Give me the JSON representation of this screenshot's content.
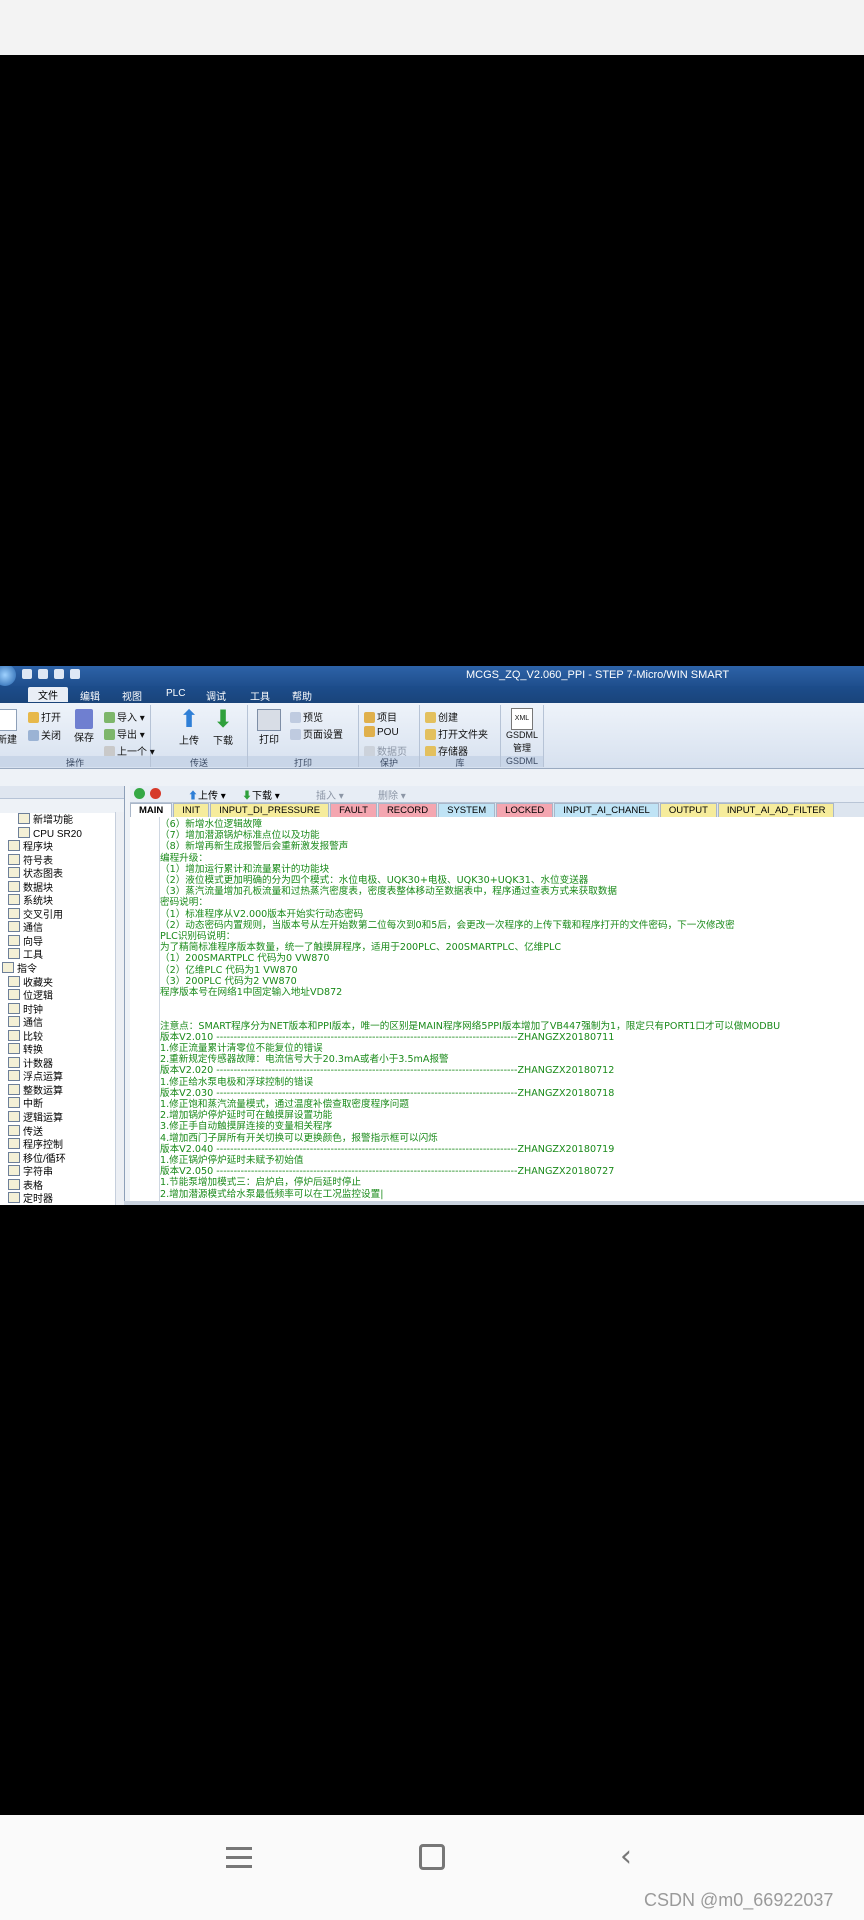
{
  "window": {
    "title": "MCGS_ZQ_V2.060_PPI - STEP 7-Micro/WIN SMART"
  },
  "menu": [
    "文件",
    "编辑",
    "视图",
    "PLC",
    "调试",
    "工具",
    "帮助"
  ],
  "ribbon": {
    "groups": [
      {
        "label": "操作",
        "items": [
          "新建",
          "打开",
          "关闭",
          "保存",
          "导入",
          "导出",
          "上一个"
        ]
      },
      {
        "label": "传送",
        "items": [
          "上传",
          "下载"
        ]
      },
      {
        "label": "打印",
        "items": [
          "打印",
          "预览",
          "页面设置"
        ]
      },
      {
        "label": "保护",
        "items": [
          "项目",
          "POU",
          "数据页"
        ]
      },
      {
        "label": "库",
        "items": [
          "创建",
          "打开文件夹",
          "存储器"
        ]
      },
      {
        "label": "GSDML",
        "items": [
          "XML",
          "GSDML 管理"
        ]
      }
    ]
  },
  "tree": {
    "items": [
      "新增功能",
      "CPU SR20",
      "程序块",
      "符号表",
      "状态图表",
      "数据块",
      "系统块",
      "交叉引用",
      "通信",
      "向导",
      "工具",
      "指令",
      "收藏夹",
      "位逻辑",
      "时钟",
      "通信",
      "比较",
      "转换",
      "计数器",
      "浮点运算",
      "整数运算",
      "中断",
      "逻辑运算",
      "传送",
      "程序控制",
      "移位/循环",
      "字符串",
      "表格",
      "定时器"
    ]
  },
  "editor_toolbar": {
    "upload": "上传",
    "download": "下载",
    "insert": "插入",
    "delete": "删除"
  },
  "tabs": [
    "MAIN",
    "INIT",
    "INPUT_DI_PRESSURE",
    "FAULT",
    "RECORD",
    "SYSTEM",
    "LOCKED",
    "INPUT_AI_CHANEL",
    "OUTPUT",
    "INPUT_AI_AD_FILTER"
  ],
  "editor_lines": [
    "（6）新增水位逻辑故障",
    "（7）增加潜源锅炉标准点位以及功能",
    "（8）新增再新生成报警后会重新激发报警声",
    "编程升级：",
    "（1）增加运行累计和流量累计的功能块",
    "（2）液位模式更加明确的分为四个模式：水位电极、UQK30+电极、UQK30+UQK31、水位变送器",
    "（3）蒸汽流量增加孔板流量和过热蒸汽密度表，密度表整体移动至数据表中，程序通过查表方式来获取数据",
    "密码说明：",
    "（1）标准程序从V2.000版本开始实行动态密码",
    "（2）动态密码内置规则，当版本号从左开始数第二位每次到0和5后，会更改一次程序的上传下载和程序打开的文件密码，下一次修改密",
    "PLC识别码说明：",
    "为了精简标准程序版本数量，统一了触摸屏程序，适用于200PLC、200SMARTPLC、亿维PLC",
    "（1）200SMARTPLC 代码为0 VW870",
    "（2）亿维PLC        代码为1 VW870",
    "（3）200PLC          代码为2 VW870",
    "程序版本号在网络1中固定输入地址VD872",
    "",
    "",
    "注意点：SMART程序分为NET版本和PPI版本，唯一的区别是MAIN程序网络5PPI版本增加了VB447强制为1，限定只有PORT1口才可以做MODBU",
    "版本V2.010 ---------------------------------------------------------------------------------------ZHANGZX20180711",
    "1.修正流量累计清零位不能复位的错误",
    "2.重新规定传感器故障：电流信号大于20.3mA或者小于3.5mA报警",
    "版本V2.020 ---------------------------------------------------------------------------------------ZHANGZX20180712",
    "1.修正给水泵电极和浮球控制的错误",
    "版本V2.030 ---------------------------------------------------------------------------------------ZHANGZX20180718",
    "1.修正饱和蒸汽流量模式，通过温度补偿查取密度程序问题",
    "2.增加锅炉停炉延时可在触摸屏设置功能",
    "3.修正手自动触摸屏连接的变量相关程序",
    "4.增加西门子屏所有开关切换可以更换颜色，报警指示框可以闪烁",
    "版本V2.040 ---------------------------------------------------------------------------------------ZHANGZX20180719",
    "1.修正锅炉停炉延时未赋予初始值",
    "版本V2.050 ---------------------------------------------------------------------------------------ZHANGZX20180727",
    "1.节能泵增加模式三：启炉启，停炉后延时停止",
    "2.增加潜源模式给水泵最低频率可以在工况监控设置|"
  ],
  "colors": {
    "editor_text": "#1a8a1a",
    "title_bar": "#2d63a8"
  },
  "watermark": "CSDN @m0_66922037"
}
